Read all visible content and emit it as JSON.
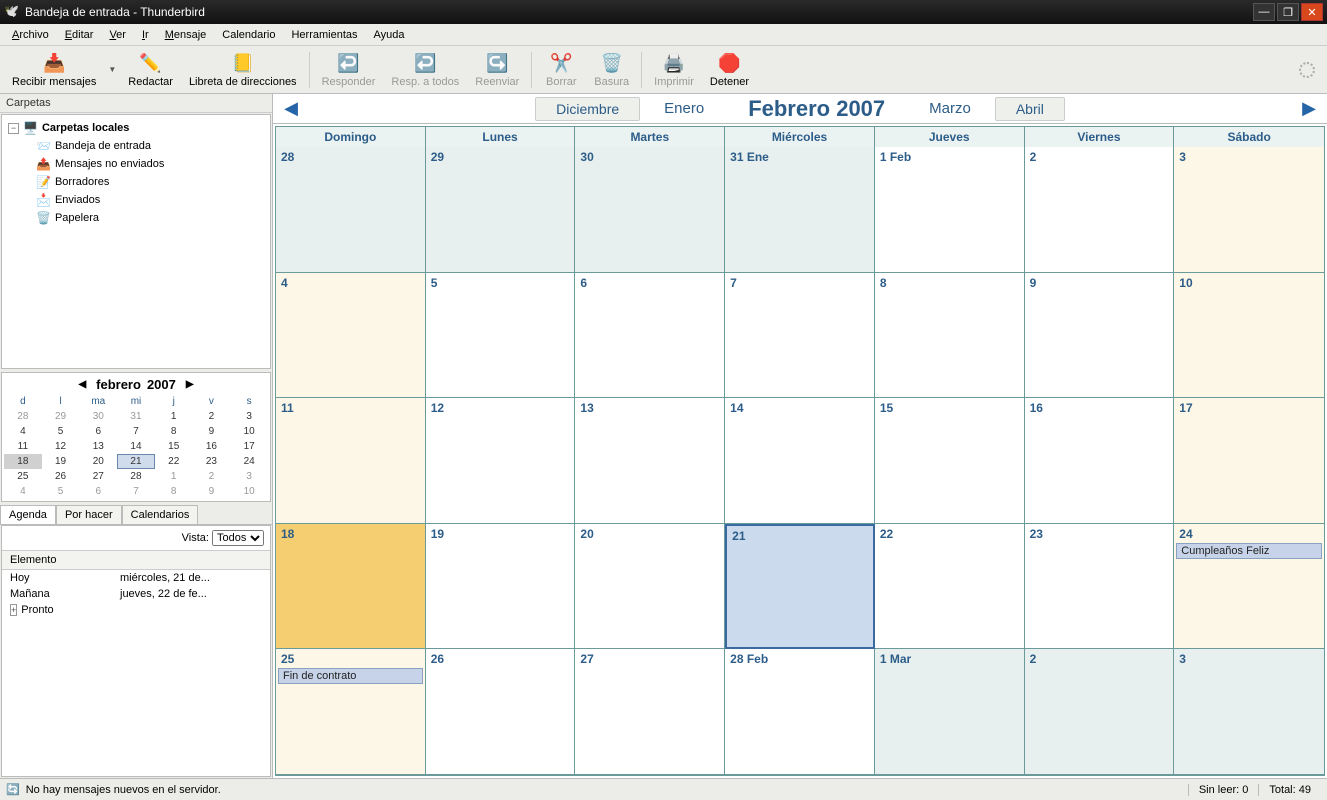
{
  "window": {
    "title": "Bandeja de entrada - Thunderbird"
  },
  "menu": [
    "Archivo",
    "Editar",
    "Ver",
    "Ir",
    "Mensaje",
    "Calendario",
    "Herramientas",
    "Ayuda"
  ],
  "toolbar": {
    "recibir": "Recibir mensajes",
    "redactar": "Redactar",
    "libreta": "Libreta de direcciones",
    "responder": "Responder",
    "resp_todos": "Resp. a todos",
    "reenviar": "Reenviar",
    "borrar": "Borrar",
    "basura": "Basura",
    "imprimir": "Imprimir",
    "detener": "Detener"
  },
  "folders": {
    "header": "Carpetas",
    "root": "Carpetas locales",
    "items": [
      "Bandeja de entrada",
      "Mensajes no enviados",
      "Borradores",
      "Enviados",
      "Papelera"
    ]
  },
  "minical": {
    "month": "febrero",
    "year": "2007",
    "dow": [
      "d",
      "l",
      "ma",
      "mi",
      "j",
      "v",
      "s"
    ],
    "weeks": [
      [
        {
          "d": "28",
          "o": true
        },
        {
          "d": "29",
          "o": true
        },
        {
          "d": "30",
          "o": true
        },
        {
          "d": "31",
          "o": true
        },
        {
          "d": "1"
        },
        {
          "d": "2"
        },
        {
          "d": "3"
        }
      ],
      [
        {
          "d": "4"
        },
        {
          "d": "5"
        },
        {
          "d": "6"
        },
        {
          "d": "7"
        },
        {
          "d": "8"
        },
        {
          "d": "9"
        },
        {
          "d": "10"
        }
      ],
      [
        {
          "d": "11"
        },
        {
          "d": "12"
        },
        {
          "d": "13"
        },
        {
          "d": "14"
        },
        {
          "d": "15"
        },
        {
          "d": "16"
        },
        {
          "d": "17"
        }
      ],
      [
        {
          "d": "18",
          "sel": true
        },
        {
          "d": "19"
        },
        {
          "d": "20"
        },
        {
          "d": "21",
          "today": true
        },
        {
          "d": "22"
        },
        {
          "d": "23"
        },
        {
          "d": "24"
        }
      ],
      [
        {
          "d": "25"
        },
        {
          "d": "26"
        },
        {
          "d": "27"
        },
        {
          "d": "28"
        },
        {
          "d": "1",
          "o": true
        },
        {
          "d": "2",
          "o": true
        },
        {
          "d": "3",
          "o": true
        }
      ],
      [
        {
          "d": "4",
          "o": true
        },
        {
          "d": "5",
          "o": true
        },
        {
          "d": "6",
          "o": true
        },
        {
          "d": "7",
          "o": true
        },
        {
          "d": "8",
          "o": true
        },
        {
          "d": "9",
          "o": true
        },
        {
          "d": "10",
          "o": true
        }
      ]
    ]
  },
  "side_tabs": [
    "Agenda",
    "Por hacer",
    "Calendarios"
  ],
  "agenda": {
    "vista_label": "Vista:",
    "vista_value": "Todos",
    "col_header": "Elemento",
    "rows": [
      {
        "label": "Hoy",
        "date": "miércoles, 21 de..."
      },
      {
        "label": "Mañana",
        "date": "jueves, 22 de fe..."
      },
      {
        "label": "Pronto",
        "date": "",
        "exp": true
      }
    ]
  },
  "monthnav": {
    "prev2": "Diciembre",
    "prev1": "Enero",
    "current": "Febrero 2007",
    "next1": "Marzo",
    "next2": "Abril"
  },
  "dow_full": [
    "Domingo",
    "Lunes",
    "Martes",
    "Miércoles",
    "Jueves",
    "Viernes",
    "Sábado"
  ],
  "cells": [
    {
      "n": "28",
      "o": true,
      "we": true
    },
    {
      "n": "29",
      "o": true
    },
    {
      "n": "30",
      "o": true
    },
    {
      "n": "31 Ene",
      "o": true
    },
    {
      "n": "1 Feb"
    },
    {
      "n": "2"
    },
    {
      "n": "3",
      "we": true
    },
    {
      "n": "4",
      "we": true
    },
    {
      "n": "5"
    },
    {
      "n": "6"
    },
    {
      "n": "7"
    },
    {
      "n": "8"
    },
    {
      "n": "9"
    },
    {
      "n": "10",
      "we": true
    },
    {
      "n": "11",
      "we": true
    },
    {
      "n": "12"
    },
    {
      "n": "13"
    },
    {
      "n": "14"
    },
    {
      "n": "15"
    },
    {
      "n": "16"
    },
    {
      "n": "17",
      "we": true
    },
    {
      "n": "18",
      "we": true,
      "sel": true
    },
    {
      "n": "19"
    },
    {
      "n": "20"
    },
    {
      "n": "21",
      "today": true
    },
    {
      "n": "22"
    },
    {
      "n": "23"
    },
    {
      "n": "24",
      "we": true,
      "ev": "Cumpleaños Feliz"
    },
    {
      "n": "25",
      "we": true,
      "ev": "Fin de contrato"
    },
    {
      "n": "26"
    },
    {
      "n": "27"
    },
    {
      "n": "28 Feb"
    },
    {
      "n": "1 Mar",
      "o": true
    },
    {
      "n": "2",
      "o": true
    },
    {
      "n": "3",
      "o": true,
      "we": true
    },
    {
      "n": "",
      "o": true,
      "hide": true
    },
    {
      "n": "",
      "o": true,
      "hide": true
    },
    {
      "n": "",
      "o": true,
      "hide": true
    },
    {
      "n": "",
      "o": true,
      "hide": true
    },
    {
      "n": "",
      "o": true,
      "hide": true
    },
    {
      "n": "",
      "o": true,
      "hide": true
    },
    {
      "n": "",
      "o": true,
      "hide": true
    }
  ],
  "status": {
    "msg": "No hay mensajes nuevos en el servidor.",
    "unread_label": "Sin leer:",
    "unread": "0",
    "total_label": "Total:",
    "total": "49"
  }
}
